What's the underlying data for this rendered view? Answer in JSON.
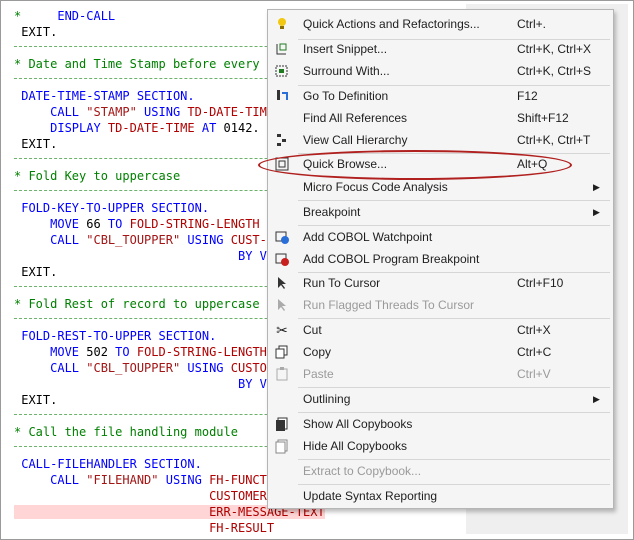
{
  "code": {
    "lines": [
      {
        "pre": "*     ",
        "seg1": "END-CALL",
        "rest": ""
      },
      {
        "text": " EXIT."
      },
      {
        "comment": "* Date and Time Stamp before every ac"
      },
      {
        "label": " DATE-TIME-STAMP",
        "kw": " SECTION."
      },
      {
        "kw1": "     CALL ",
        "str": "\"STAMP\"",
        "kw2": " USING ",
        "var": "TD-DATE-TIME."
      },
      {
        "kw1": "     DISPLAY ",
        "var": "TD-DATE-TIME",
        "kw2": " AT ",
        "plain": "0142."
      },
      {
        "text": " EXIT."
      },
      {
        "comment": "* Fold Key to uppercase"
      },
      {
        "label": " FOLD-KEY-TO-UPPER",
        "kw": " SECTION."
      },
      {
        "kw1": "     MOVE ",
        "plain": "66",
        "kw2": " TO ",
        "var": "FOLD-STRING-LENGTH"
      },
      {
        "kw1": "     CALL ",
        "str": "\"CBL_TOUPPER\"",
        "kw2": " USING ",
        "var": "CUST-CO"
      },
      {
        "kw1": "                               BY VALU"
      },
      {
        "text": " EXIT."
      },
      {
        "comment": "* Fold Rest of record to uppercase"
      },
      {
        "label": " FOLD-REST-TO-UPPER",
        "kw": " SECTION."
      },
      {
        "kw1": "     MOVE ",
        "plain": "502",
        "kw2": " TO ",
        "var": "FOLD-STRING-LENGTH"
      },
      {
        "kw1": "     CALL ",
        "str": "\"CBL_TOUPPER\"",
        "kw2": " USING ",
        "var": "CUSTOME"
      },
      {
        "kw1": "                               BY VALU"
      },
      {
        "text": " EXIT."
      },
      {
        "comment": "* Call the file handling module"
      },
      {
        "label": " CALL-FILEHANDLER",
        "kw": " SECTION."
      },
      {
        "kw1": "     CALL ",
        "str": "\"FILEHAND\"",
        "kw2": " USING ",
        "var": "FH-FUNCTIO"
      },
      {
        "var": "                           CUSTOMER-R"
      },
      {
        "var": "                           ERR-MESSAGE-TEXT"
      },
      {
        "var": "                           FH-RESULT"
      }
    ]
  },
  "menu": {
    "items": [
      {
        "name": "quick-actions",
        "icon": "lightbulb-icon",
        "label": "Quick Actions and Refactorings...",
        "shortcut": "Ctrl+."
      },
      {
        "name": "insert-snippet",
        "icon": "insert-snippet-icon",
        "label": "Insert Snippet...",
        "shortcut": "Ctrl+K, Ctrl+X"
      },
      {
        "name": "surround-with",
        "icon": "surround-with-icon",
        "label": "Surround With...",
        "shortcut": "Ctrl+K, Ctrl+S"
      },
      {
        "name": "go-to-definition",
        "icon": "go-to-definition-icon",
        "label": "Go To Definition",
        "shortcut": "F12"
      },
      {
        "name": "find-all-references",
        "icon": "",
        "label": "Find All References",
        "shortcut": "Shift+F12"
      },
      {
        "name": "view-call-hierarchy",
        "icon": "call-hierarchy-icon",
        "label": "View Call Hierarchy",
        "shortcut": "Ctrl+K, Ctrl+T"
      },
      {
        "name": "quick-browse",
        "icon": "quick-browse-icon",
        "label": "Quick Browse...",
        "shortcut": "Alt+Q"
      },
      {
        "name": "micro-focus-code-analysis",
        "icon": "",
        "label": "Micro Focus Code Analysis",
        "shortcut": "",
        "submenu": true
      },
      {
        "name": "breakpoint",
        "icon": "",
        "label": "Breakpoint",
        "shortcut": "",
        "submenu": true
      },
      {
        "name": "add-cobol-watchpoint",
        "icon": "watchpoint-icon",
        "label": "Add COBOL Watchpoint",
        "shortcut": ""
      },
      {
        "name": "add-cobol-program-breakpoint",
        "icon": "program-breakpoint-icon",
        "label": "Add COBOL Program Breakpoint",
        "shortcut": ""
      },
      {
        "name": "run-to-cursor",
        "icon": "run-to-cursor-icon",
        "label": "Run To Cursor",
        "shortcut": "Ctrl+F10"
      },
      {
        "name": "run-flagged-threads",
        "icon": "run-flagged-threads-icon",
        "label": "Run Flagged Threads To Cursor",
        "shortcut": "",
        "disabled": true
      },
      {
        "name": "cut",
        "icon": "scissors-icon",
        "label": "Cut",
        "shortcut": "Ctrl+X"
      },
      {
        "name": "copy",
        "icon": "copy-icon",
        "label": "Copy",
        "shortcut": "Ctrl+C"
      },
      {
        "name": "paste",
        "icon": "paste-icon",
        "label": "Paste",
        "shortcut": "Ctrl+V",
        "disabled": true
      },
      {
        "name": "outlining",
        "icon": "",
        "label": "Outlining",
        "shortcut": "",
        "submenu": true
      },
      {
        "name": "show-all-copybooks",
        "icon": "show-copybooks-icon",
        "label": "Show All Copybooks",
        "shortcut": ""
      },
      {
        "name": "hide-all-copybooks",
        "icon": "hide-copybooks-icon",
        "label": "Hide All Copybooks",
        "shortcut": ""
      },
      {
        "name": "extract-to-copybook",
        "icon": "",
        "label": "Extract to Copybook...",
        "shortcut": "",
        "disabled": true
      },
      {
        "name": "update-syntax-reporting",
        "icon": "",
        "label": "Update Syntax Reporting",
        "shortcut": ""
      }
    ]
  },
  "colors": {
    "keyword": "#0000ff",
    "string": "#a31515",
    "variable": "#b00000",
    "comment": "#008000",
    "highlight_oval": "#b0201f"
  }
}
